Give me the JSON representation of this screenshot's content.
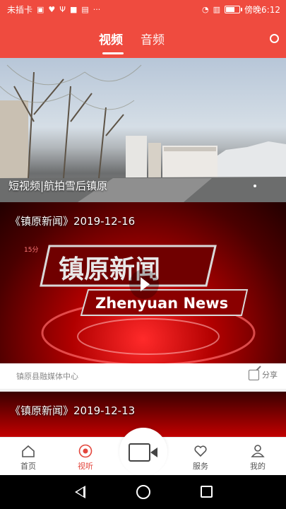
{
  "status_bar": {
    "carrier": "未插卡",
    "icons_left": [
      "image-icon",
      "heart-icon",
      "usb-icon",
      "app-icon",
      "notification-icon",
      "more-icon"
    ],
    "time": "傍晚6:12"
  },
  "header": {
    "tabs": [
      {
        "label": "视频",
        "active": true
      },
      {
        "label": "音频",
        "active": false
      }
    ]
  },
  "banner": {
    "caption": "短视频|航拍雪后镇原"
  },
  "video_cards": [
    {
      "title": "《镇原新闻》2019-12-16",
      "thumb_title_cn": "镇原新闻",
      "thumb_title_en": "Zhenyuan News",
      "source": "镇原县融媒体中心",
      "share_label": "分享"
    },
    {
      "title": "《镇原新闻》2019-12-13"
    }
  ],
  "bottom_nav": [
    {
      "label": "首页",
      "icon": "home-icon"
    },
    {
      "label": "视听",
      "icon": "play-circle-icon",
      "active": true
    },
    {
      "label": "",
      "icon": "camera-icon"
    },
    {
      "label": "服务",
      "icon": "heart-icon"
    },
    {
      "label": "我的",
      "icon": "user-icon"
    }
  ],
  "colors": {
    "accent": "#ef4b3f",
    "nav_active": "#e3463c"
  }
}
